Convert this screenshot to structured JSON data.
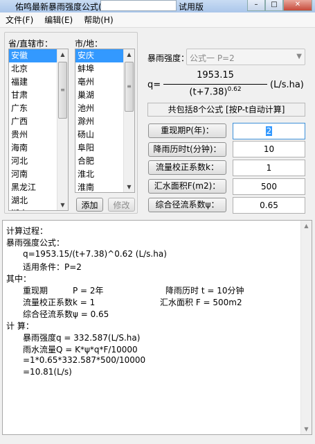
{
  "window": {
    "title": "佑鸣最新暴雨强度公式(V",
    "title_suffix": "试用版",
    "min_icon": "minimize-icon",
    "max_icon": "maximize-icon",
    "close_icon": "close-icon"
  },
  "menu": [
    {
      "label": "文件(F)"
    },
    {
      "label": "编辑(E)"
    },
    {
      "label": "帮助(H)"
    }
  ],
  "province": {
    "label": "省/直辖市：",
    "items": [
      "安徽",
      "北京",
      "福建",
      "甘肃",
      "广东",
      "广西",
      "贵州",
      "海南",
      "河北",
      "河南",
      "黑龙江",
      "湖北",
      "湖南"
    ],
    "selected": "安徽"
  },
  "city": {
    "label": "市/地：",
    "items": [
      "安庆",
      "蚌埠",
      "亳州",
      "巢湖",
      "池州",
      "滁州",
      "砀山",
      "阜阳",
      "合肥",
      "淮北",
      "淮南",
      "黄山"
    ],
    "selected": "安庆"
  },
  "buttons": {
    "add": "添加",
    "edit": "修改"
  },
  "intensity": {
    "label": "暴雨强度：",
    "selected": "公式一 P=2"
  },
  "formula": {
    "lhs": "q=",
    "numerator": "1953.15",
    "denominator": "(t+7.38)",
    "exponent": "0.62",
    "unit": "(L/s.ha)"
  },
  "info": "共包括8个公式 [按P-t自动计算]",
  "params": [
    {
      "label": "重现期P(年)：",
      "value": "2"
    },
    {
      "label": "降雨历时t(分钟)：",
      "value": "10"
    },
    {
      "label": "流量校正系数k：",
      "value": "1"
    },
    {
      "label": "汇水面积F(m2)：",
      "value": "500"
    },
    {
      "label": "综合径流系数ψ：",
      "value": "0.65"
    }
  ],
  "calc": {
    "l1": "计算过程：",
    "l2": "暴雨强度公式：",
    "l3": "q=1953.15/(t+7.38)^0.62 (L/s.ha)",
    "l4": "适用条件：P=2",
    "l5": "其中：",
    "l6a": "重现期",
    "l6b": "P = 2年",
    "l6c": "降雨历时 t = 10分钟",
    "l7a": "流量校正系数k = 1",
    "l7b": "汇水面积 F = 500m2",
    "l8": "综合径流系数ψ = 0.65",
    "l9": "计 算：",
    "l10": "暴雨强度q = 332.587(L/S.ha)",
    "l11": "雨水流量Q = K*ψ*q*F/10000",
    "l12": "=1*0.65*332.587*500/10000",
    "l13": "=10.81(L/s)"
  }
}
